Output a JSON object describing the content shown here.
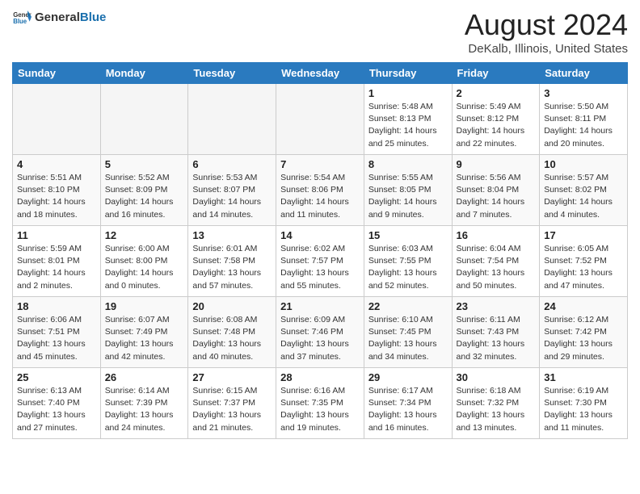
{
  "header": {
    "logo_general": "General",
    "logo_blue": "Blue",
    "month_title": "August 2024",
    "location": "DeKalb, Illinois, United States"
  },
  "weekdays": [
    "Sunday",
    "Monday",
    "Tuesday",
    "Wednesday",
    "Thursday",
    "Friday",
    "Saturday"
  ],
  "weeks": [
    [
      {
        "day": "",
        "empty": true
      },
      {
        "day": "",
        "empty": true
      },
      {
        "day": "",
        "empty": true
      },
      {
        "day": "",
        "empty": true
      },
      {
        "day": "1",
        "info": "Sunrise: 5:48 AM\nSunset: 8:13 PM\nDaylight: 14 hours\nand 25 minutes."
      },
      {
        "day": "2",
        "info": "Sunrise: 5:49 AM\nSunset: 8:12 PM\nDaylight: 14 hours\nand 22 minutes."
      },
      {
        "day": "3",
        "info": "Sunrise: 5:50 AM\nSunset: 8:11 PM\nDaylight: 14 hours\nand 20 minutes."
      }
    ],
    [
      {
        "day": "4",
        "info": "Sunrise: 5:51 AM\nSunset: 8:10 PM\nDaylight: 14 hours\nand 18 minutes."
      },
      {
        "day": "5",
        "info": "Sunrise: 5:52 AM\nSunset: 8:09 PM\nDaylight: 14 hours\nand 16 minutes."
      },
      {
        "day": "6",
        "info": "Sunrise: 5:53 AM\nSunset: 8:07 PM\nDaylight: 14 hours\nand 14 minutes."
      },
      {
        "day": "7",
        "info": "Sunrise: 5:54 AM\nSunset: 8:06 PM\nDaylight: 14 hours\nand 11 minutes."
      },
      {
        "day": "8",
        "info": "Sunrise: 5:55 AM\nSunset: 8:05 PM\nDaylight: 14 hours\nand 9 minutes."
      },
      {
        "day": "9",
        "info": "Sunrise: 5:56 AM\nSunset: 8:04 PM\nDaylight: 14 hours\nand 7 minutes."
      },
      {
        "day": "10",
        "info": "Sunrise: 5:57 AM\nSunset: 8:02 PM\nDaylight: 14 hours\nand 4 minutes."
      }
    ],
    [
      {
        "day": "11",
        "info": "Sunrise: 5:59 AM\nSunset: 8:01 PM\nDaylight: 14 hours\nand 2 minutes."
      },
      {
        "day": "12",
        "info": "Sunrise: 6:00 AM\nSunset: 8:00 PM\nDaylight: 14 hours\nand 0 minutes."
      },
      {
        "day": "13",
        "info": "Sunrise: 6:01 AM\nSunset: 7:58 PM\nDaylight: 13 hours\nand 57 minutes."
      },
      {
        "day": "14",
        "info": "Sunrise: 6:02 AM\nSunset: 7:57 PM\nDaylight: 13 hours\nand 55 minutes."
      },
      {
        "day": "15",
        "info": "Sunrise: 6:03 AM\nSunset: 7:55 PM\nDaylight: 13 hours\nand 52 minutes."
      },
      {
        "day": "16",
        "info": "Sunrise: 6:04 AM\nSunset: 7:54 PM\nDaylight: 13 hours\nand 50 minutes."
      },
      {
        "day": "17",
        "info": "Sunrise: 6:05 AM\nSunset: 7:52 PM\nDaylight: 13 hours\nand 47 minutes."
      }
    ],
    [
      {
        "day": "18",
        "info": "Sunrise: 6:06 AM\nSunset: 7:51 PM\nDaylight: 13 hours\nand 45 minutes."
      },
      {
        "day": "19",
        "info": "Sunrise: 6:07 AM\nSunset: 7:49 PM\nDaylight: 13 hours\nand 42 minutes."
      },
      {
        "day": "20",
        "info": "Sunrise: 6:08 AM\nSunset: 7:48 PM\nDaylight: 13 hours\nand 40 minutes."
      },
      {
        "day": "21",
        "info": "Sunrise: 6:09 AM\nSunset: 7:46 PM\nDaylight: 13 hours\nand 37 minutes."
      },
      {
        "day": "22",
        "info": "Sunrise: 6:10 AM\nSunset: 7:45 PM\nDaylight: 13 hours\nand 34 minutes."
      },
      {
        "day": "23",
        "info": "Sunrise: 6:11 AM\nSunset: 7:43 PM\nDaylight: 13 hours\nand 32 minutes."
      },
      {
        "day": "24",
        "info": "Sunrise: 6:12 AM\nSunset: 7:42 PM\nDaylight: 13 hours\nand 29 minutes."
      }
    ],
    [
      {
        "day": "25",
        "info": "Sunrise: 6:13 AM\nSunset: 7:40 PM\nDaylight: 13 hours\nand 27 minutes."
      },
      {
        "day": "26",
        "info": "Sunrise: 6:14 AM\nSunset: 7:39 PM\nDaylight: 13 hours\nand 24 minutes."
      },
      {
        "day": "27",
        "info": "Sunrise: 6:15 AM\nSunset: 7:37 PM\nDaylight: 13 hours\nand 21 minutes."
      },
      {
        "day": "28",
        "info": "Sunrise: 6:16 AM\nSunset: 7:35 PM\nDaylight: 13 hours\nand 19 minutes."
      },
      {
        "day": "29",
        "info": "Sunrise: 6:17 AM\nSunset: 7:34 PM\nDaylight: 13 hours\nand 16 minutes."
      },
      {
        "day": "30",
        "info": "Sunrise: 6:18 AM\nSunset: 7:32 PM\nDaylight: 13 hours\nand 13 minutes."
      },
      {
        "day": "31",
        "info": "Sunrise: 6:19 AM\nSunset: 7:30 PM\nDaylight: 13 hours\nand 11 minutes."
      }
    ]
  ]
}
